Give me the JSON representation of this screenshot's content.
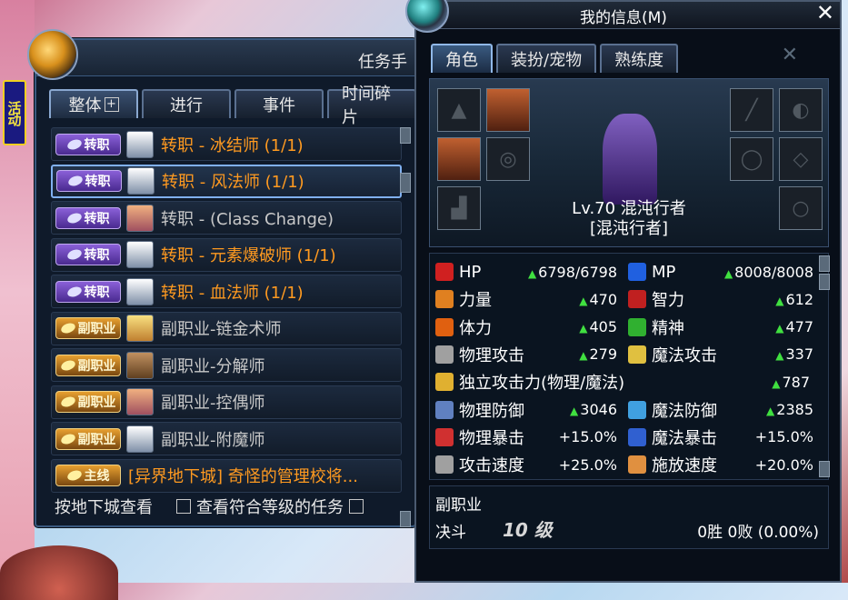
{
  "activity": {
    "label": "活动"
  },
  "quest": {
    "title": "任务手",
    "tabs": [
      {
        "label": "整体"
      },
      {
        "label": "进行"
      },
      {
        "label": "事件"
      },
      {
        "label": "时间碎片"
      }
    ],
    "items": [
      {
        "badge": "转职",
        "badge_type": "job",
        "portrait": "white",
        "text": "转职 - 冰结师 (1/1)",
        "color": "orange"
      },
      {
        "badge": "转职",
        "badge_type": "job",
        "portrait": "white",
        "text": "转职 - 风法师 (1/1)",
        "color": "orange",
        "selected": true
      },
      {
        "badge": "转职",
        "badge_type": "job",
        "portrait": "fem",
        "text": "转职 - (Class Change)",
        "color": "gray"
      },
      {
        "badge": "转职",
        "badge_type": "job",
        "portrait": "white",
        "text": "转职 - 元素爆破师 (1/1)",
        "color": "orange"
      },
      {
        "badge": "转职",
        "badge_type": "job",
        "portrait": "white",
        "text": "转职 - 血法师 (1/1)",
        "color": "orange"
      },
      {
        "badge": "副职业",
        "badge_type": "sub",
        "portrait": "gold",
        "text": "副职业-链金术师",
        "color": "gray"
      },
      {
        "badge": "副职业",
        "badge_type": "sub",
        "portrait": "brown",
        "text": "副职业-分解师",
        "color": "gray"
      },
      {
        "badge": "副职业",
        "badge_type": "sub",
        "portrait": "fem",
        "text": "副职业-控偶师",
        "color": "gray"
      },
      {
        "badge": "副职业",
        "badge_type": "sub",
        "portrait": "white",
        "text": "副职业-附魔师",
        "color": "gray"
      },
      {
        "badge": "主线",
        "badge_type": "main",
        "portrait": "",
        "text": "[异界地下城] 奇怪的管理校将...",
        "color": "main"
      }
    ],
    "footer": {
      "left": "按地下城查看",
      "check_label": "查看符合等级的任务"
    }
  },
  "char": {
    "title": "我的信息(M)",
    "tabs": [
      {
        "label": "角色"
      },
      {
        "label": "装扮/宠物"
      },
      {
        "label": "熟练度"
      }
    ],
    "level_line": "Lv.70 混沌行者",
    "class_line": "[混沌行者]",
    "stats": [
      {
        "label": "HP",
        "value": "6798/6798",
        "up": true,
        "icon_color": "#d02020"
      },
      {
        "label": "MP",
        "value": "8008/8008",
        "up": true,
        "icon_color": "#2060e0"
      },
      {
        "label": "力量",
        "value": "470",
        "up": true,
        "icon_color": "#e08020"
      },
      {
        "label": "智力",
        "value": "612",
        "up": true,
        "icon_color": "#c02020"
      },
      {
        "label": "体力",
        "value": "405",
        "up": true,
        "icon_color": "#e06010"
      },
      {
        "label": "精神",
        "value": "477",
        "up": true,
        "icon_color": "#30b030"
      },
      {
        "label": "物理攻击",
        "value": "279",
        "up": true,
        "icon_color": "#a0a0a0"
      },
      {
        "label": "魔法攻击",
        "value": "337",
        "up": true,
        "icon_color": "#e0c040"
      },
      {
        "label": "独立攻击力(物理/魔法)",
        "value": "787",
        "up": true,
        "icon_color": "#e0b030"
      },
      {
        "label": "物理防御",
        "value": "3046",
        "up": true,
        "icon_color": "#6080c0"
      },
      {
        "label": "魔法防御",
        "value": "2385",
        "up": true,
        "icon_color": "#40a0e0"
      },
      {
        "label": "物理暴击",
        "value": "+15.0%",
        "up": false,
        "icon_color": "#d03030"
      },
      {
        "label": "魔法暴击",
        "value": "+15.0%",
        "up": false,
        "icon_color": "#3060d0"
      },
      {
        "label": "攻击速度",
        "value": "+25.0%",
        "up": false,
        "icon_color": "#a0a0a0"
      },
      {
        "label": "施放速度",
        "value": "+20.0%",
        "up": false,
        "icon_color": "#e09040"
      }
    ],
    "sub_job": {
      "label": "副职业",
      "duel_label": "决斗",
      "duel_level": "10 级",
      "record": "0胜 0败 (0.00%)"
    }
  }
}
